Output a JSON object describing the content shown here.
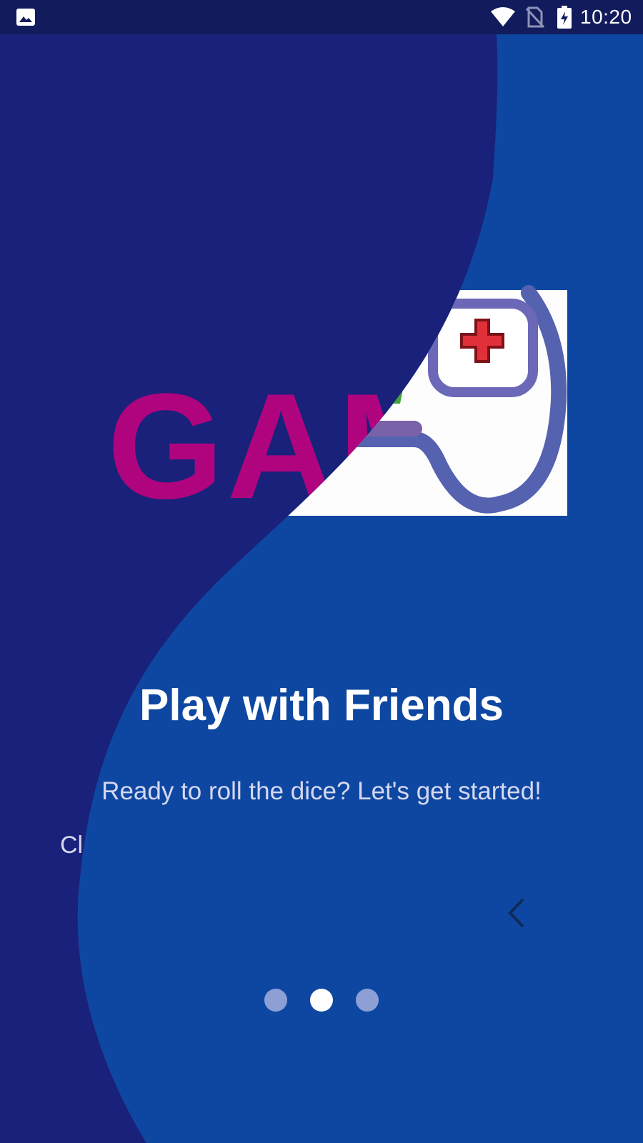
{
  "status_bar": {
    "time": "10:20",
    "icons": [
      "image-icon",
      "wifi-icon",
      "no-sim-icon",
      "battery-charging-icon"
    ]
  },
  "slide": {
    "title": "Play with Friends",
    "subtitle": "Ready to roll the dice? Let's get started!"
  },
  "previous_slide": {
    "logo_text": "GAME",
    "subtitle_fragment": "Cl"
  },
  "pager": {
    "page_count": 3,
    "active_index": 1
  },
  "nav": {
    "back_icon": "chevron-left-icon"
  },
  "colors": {
    "background_dark": "#1A217A",
    "background_light": "#0E47A1",
    "status_bar": "#121B5C",
    "logo_magenta": "#B0047F",
    "dot_inactive": "#8CA0D6",
    "dot_active": "#FFFFFF"
  }
}
